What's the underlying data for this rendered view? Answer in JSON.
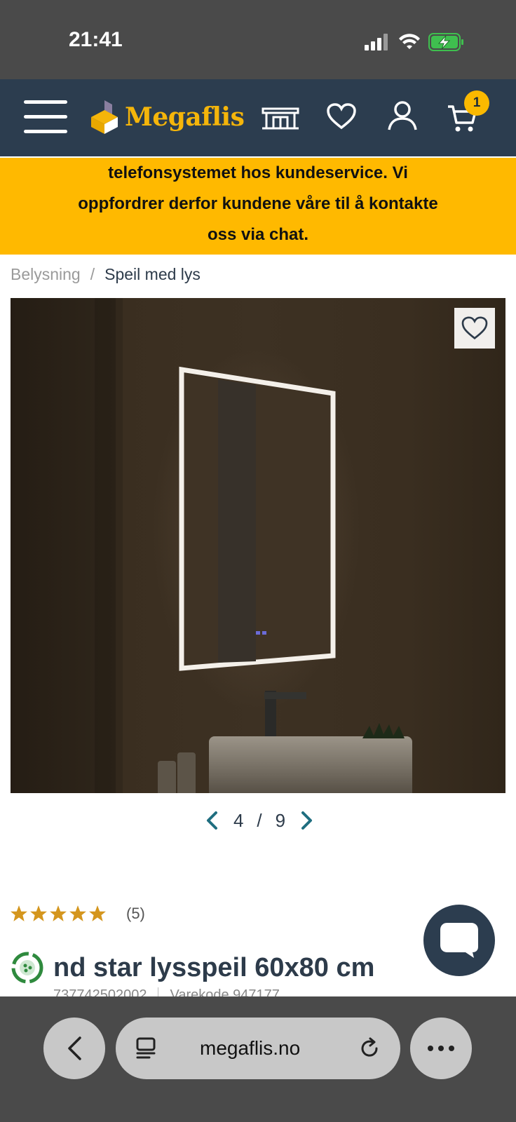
{
  "status_bar": {
    "time": "21:41"
  },
  "header": {
    "logo_text": "Megaflis",
    "cart_count": "1"
  },
  "notice": {
    "lines": [
      "telefonsystemet hos kundeservice. Vi",
      "oppfordrer derfor kundene våre til å kontakte",
      "oss via chat."
    ]
  },
  "breadcrumb": {
    "parent": "Belysning",
    "separator": "/",
    "current": "Speil med lys"
  },
  "gallery": {
    "current": "4",
    "separator": "/",
    "total": "9"
  },
  "rating": {
    "stars": 5,
    "count_label": "(5)",
    "star_color": "#d4961e"
  },
  "product": {
    "title": "nd star lysspeil 60x80 cm",
    "sku_partial": "737742502002",
    "code_partial": "Varekode 947177"
  },
  "browser": {
    "url": "megaflis.no"
  },
  "colors": {
    "header_bg": "#2c3d4f",
    "accent_yellow": "#ffb900",
    "logo_yellow": "#f5b50a",
    "pager_arrow": "#1f6e80"
  }
}
